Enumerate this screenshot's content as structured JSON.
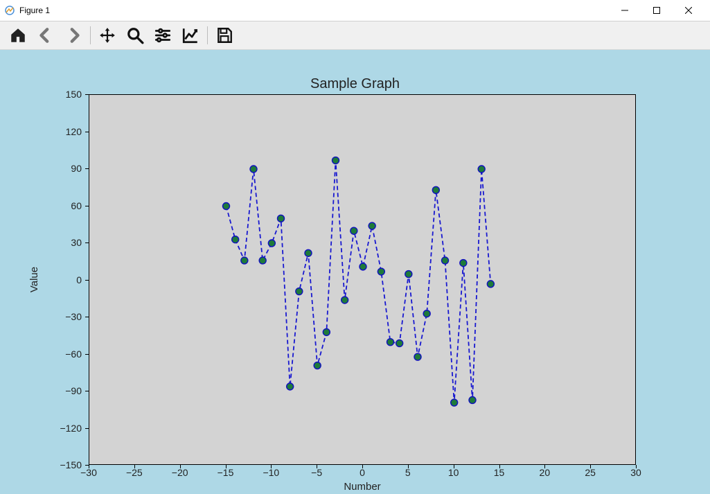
{
  "window": {
    "title": "Figure 1"
  },
  "toolbar": {
    "items": [
      {
        "name": "home-icon"
      },
      {
        "name": "back-icon"
      },
      {
        "name": "forward-icon"
      },
      {
        "sep": true
      },
      {
        "name": "pan-icon"
      },
      {
        "name": "zoom-icon"
      },
      {
        "name": "configure-icon"
      },
      {
        "name": "axis-edit-icon"
      },
      {
        "sep": true
      },
      {
        "name": "save-icon"
      }
    ]
  },
  "chart_data": {
    "type": "line",
    "title": "Sample Graph",
    "xlabel": "Number",
    "ylabel": "Value",
    "xlim": [
      -30,
      30
    ],
    "ylim": [
      -150,
      150
    ],
    "xticks": [
      -30,
      -25,
      -20,
      -15,
      -10,
      -5,
      0,
      5,
      10,
      15,
      20,
      25,
      30
    ],
    "yticks": [
      -150,
      -120,
      -90,
      -60,
      -30,
      0,
      30,
      60,
      90,
      120,
      150
    ],
    "x": [
      -15,
      -14,
      -13,
      -12,
      -11,
      -10,
      -9,
      -8,
      -7,
      -6,
      -5,
      -4,
      -3,
      -2,
      -1,
      0,
      1,
      2,
      3,
      4,
      5,
      6,
      7,
      8,
      9,
      10,
      11,
      12,
      13,
      14
    ],
    "values": [
      60,
      33,
      16,
      90,
      16,
      30,
      50,
      -86,
      -9,
      22,
      -69,
      -42,
      97,
      -16,
      40,
      11,
      44,
      7,
      -50,
      -51,
      5,
      -62,
      -27,
      73,
      16,
      -99,
      14,
      -97,
      90,
      -3
    ],
    "marker_color": "#1e7a3a",
    "marker_edge": "#1010c0",
    "line_color": "#1818d0",
    "line_dash": "6,4"
  }
}
